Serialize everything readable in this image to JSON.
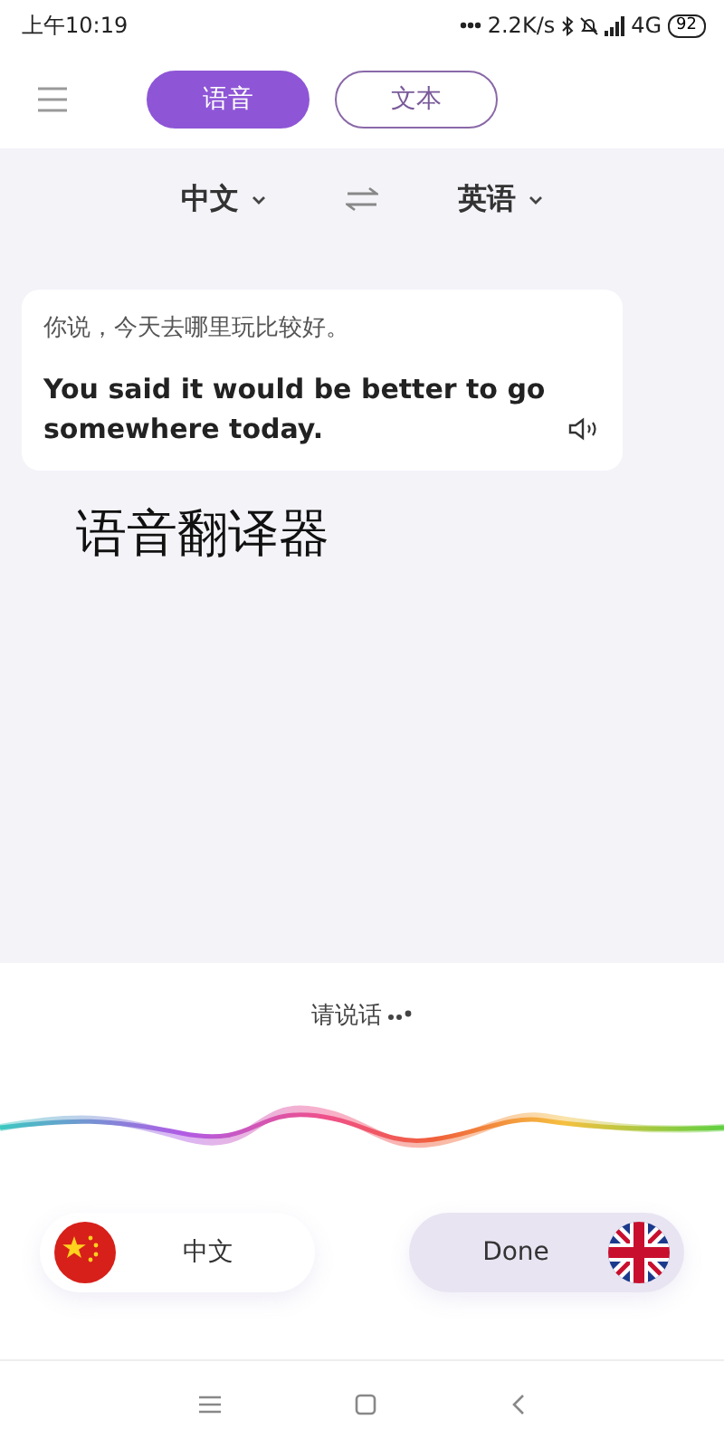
{
  "status_bar": {
    "time": "上午10:19",
    "speed": "2.2K/s",
    "network": "4G",
    "battery": "92"
  },
  "tabs": [
    {
      "label": "语音",
      "selected": true
    },
    {
      "label": "文本",
      "selected": false
    }
  ],
  "languages": {
    "source": "中文",
    "target": "英语"
  },
  "result": {
    "source_text": "你说，今天去哪里玩比较好。",
    "translation": "You said it would be better to go somewhere today."
  },
  "caption": "语音翻译器",
  "prompt": "请说话",
  "speak_buttons": [
    {
      "label": "中文",
      "kind": "china",
      "active": false
    },
    {
      "label": "Done",
      "kind": "uk",
      "active": true
    }
  ]
}
